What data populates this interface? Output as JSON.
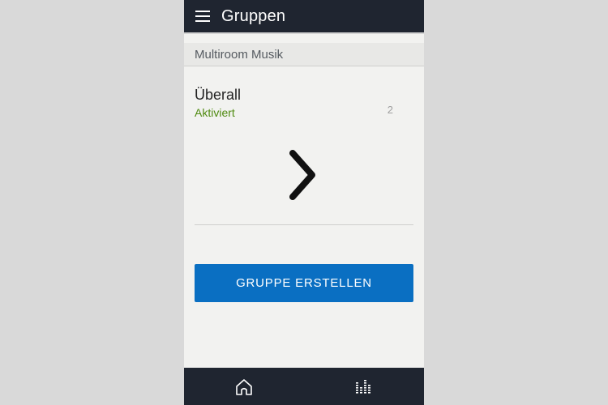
{
  "header": {
    "title": "Gruppen",
    "menu_icon": "hamburger-menu-icon"
  },
  "section": {
    "title": "Multiroom Musik"
  },
  "groups": [
    {
      "name": "Überall",
      "status": "Aktiviert",
      "count": "2",
      "icon": "chevron-right-icon"
    }
  ],
  "actions": {
    "create_group_label": "GRUPPE ERSTELLEN"
  },
  "bottom_nav": {
    "items": [
      {
        "icon": "home-icon"
      },
      {
        "icon": "music-equalizer-icon"
      }
    ]
  },
  "colors": {
    "topbar": "#1f2530",
    "background": "#f2f2f0",
    "status_green": "#4f8a10",
    "button_blue": "#0a6fc2"
  }
}
